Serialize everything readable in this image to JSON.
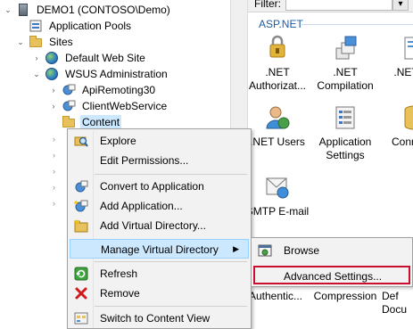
{
  "tree": {
    "root": "DEMO1 (CONTOSO\\Demo)",
    "app_pools": "Application Pools",
    "sites": "Sites",
    "default_site": "Default Web Site",
    "wsus": "WSUS Administration",
    "api": "ApiRemoting30",
    "client": "ClientWebService",
    "content": "Content"
  },
  "right": {
    "filter_label": "Filter:",
    "section": "ASP.NET",
    "features": [
      {
        "label": ".NET Authorizat..."
      },
      {
        "label": ".NET Compilation"
      },
      {
        "label": ".NET Pa"
      },
      {
        "label": ".NET Users"
      },
      {
        "label": "Application Settings"
      },
      {
        "label": "Conn Stri"
      },
      {
        "label": "SMTP E-mail"
      }
    ],
    "bottom_labels": [
      "Authentic...",
      "Compression",
      "Def Docu"
    ]
  },
  "context_menu": {
    "items": [
      {
        "label": "Explore",
        "icon": "explore-icon"
      },
      {
        "label": "Edit Permissions...",
        "icon": ""
      },
      {
        "label": "Convert to Application",
        "icon": "convert-icon"
      },
      {
        "label": "Add Application...",
        "icon": "add-application-icon"
      },
      {
        "label": "Add Virtual Directory...",
        "icon": "add-virtual-directory-icon"
      },
      {
        "label": "Manage Virtual Directory",
        "icon": ""
      },
      {
        "label": "Refresh",
        "icon": "refresh-icon"
      },
      {
        "label": "Remove",
        "icon": "remove-icon"
      },
      {
        "label": "Switch to Content View",
        "icon": "content-view-icon"
      }
    ]
  },
  "submenu": {
    "items": [
      {
        "label": "Browse",
        "icon": "browse-icon"
      },
      {
        "label": "Advanced Settings...",
        "icon": ""
      }
    ]
  },
  "colors": {
    "selection": "#cce8ff",
    "menu_bg": "#f2f2f2",
    "accent_red": "#c8102e",
    "section_blue": "#1e5aa0"
  }
}
